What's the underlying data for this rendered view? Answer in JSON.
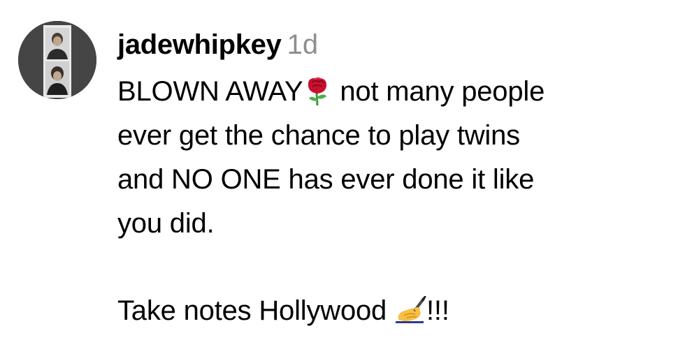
{
  "comment": {
    "username": "jadewhipkey",
    "timestamp": "1d",
    "avatar_icon": "photo-booth-avatar",
    "lines": [
      {
        "before": "BLOWN AWAY",
        "emoji": "rose-emoji",
        "after": " not many people"
      },
      "ever get the chance to play twins",
      "and NO ONE has ever done it like",
      "you did.",
      {
        "before": "Take notes Hollywood ",
        "emoji": "writing-hand-emoji",
        "after": "!!!"
      }
    ]
  },
  "colors": {
    "text": "#000000",
    "timestamp": "#8e8e8e",
    "background": "#ffffff"
  }
}
